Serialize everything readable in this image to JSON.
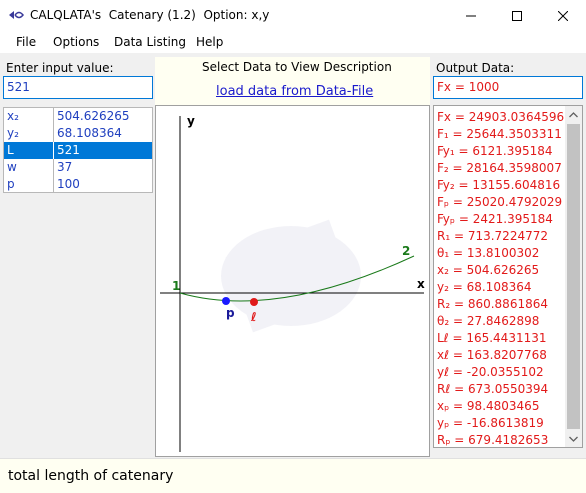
{
  "window": {
    "title": "CALQLATA's  Catenary (1.2)  Option: x,y"
  },
  "menu": {
    "items": [
      "File",
      "Options",
      "Data Listing",
      "Help"
    ]
  },
  "input": {
    "label": "Enter input value:",
    "value": "521"
  },
  "center": {
    "heading": "Select Data to View Description",
    "link": "load data from Data-File"
  },
  "output": {
    "label": "Output Data:",
    "value": "Fx = 1000",
    "lines": [
      "Fx = 24903.0364596",
      "F₁ = 25644.3503311",
      "Fy₁ = 6121.395184",
      "F₂ = 28164.3598007",
      "Fy₂ = 13155.604816",
      "Fₚ = 25020.4792029",
      "Fyₚ = 2421.395184",
      "R₁ = 713.7224772",
      "θ₁ = 13.8100302",
      "x₂ = 504.626265",
      "y₂ = 68.108364",
      "R₂ = 860.8861864",
      "θ₂ = 27.8462898",
      "Lℓ = 165.4431131",
      "xℓ = 163.8207768",
      "yℓ = -20.0355102",
      "Rℓ = 673.0550394",
      "xₚ = 98.4803465",
      "yₚ = -16.8613819",
      "Rₚ = 679.4182653"
    ]
  },
  "table": {
    "rows": [
      {
        "key": "x₂",
        "value": "504.626265",
        "selected": false
      },
      {
        "key": "y₂",
        "value": "68.108364",
        "selected": false
      },
      {
        "key": "L",
        "value": "521",
        "selected": true
      },
      {
        "key": "w",
        "value": "37",
        "selected": false
      },
      {
        "key": "p",
        "value": "100",
        "selected": false
      }
    ]
  },
  "plot": {
    "x_axis_label": "x",
    "y_axis_label": "y",
    "point_1_label": "1",
    "point_2_label": "2",
    "point_p_label": "p",
    "point_l_label": "ℓ",
    "colors": {
      "curve": "#1a7a1a",
      "point_p": "#1a1aff",
      "point_l": "#e01a1a",
      "label_end": "#1a7a1a"
    }
  },
  "status": {
    "text": "total length of catenary"
  },
  "colors": {
    "output_text": "#e21a1a",
    "table_text": "#1f3fbf",
    "selection": "#0078d7",
    "link": "#1a1acc"
  }
}
